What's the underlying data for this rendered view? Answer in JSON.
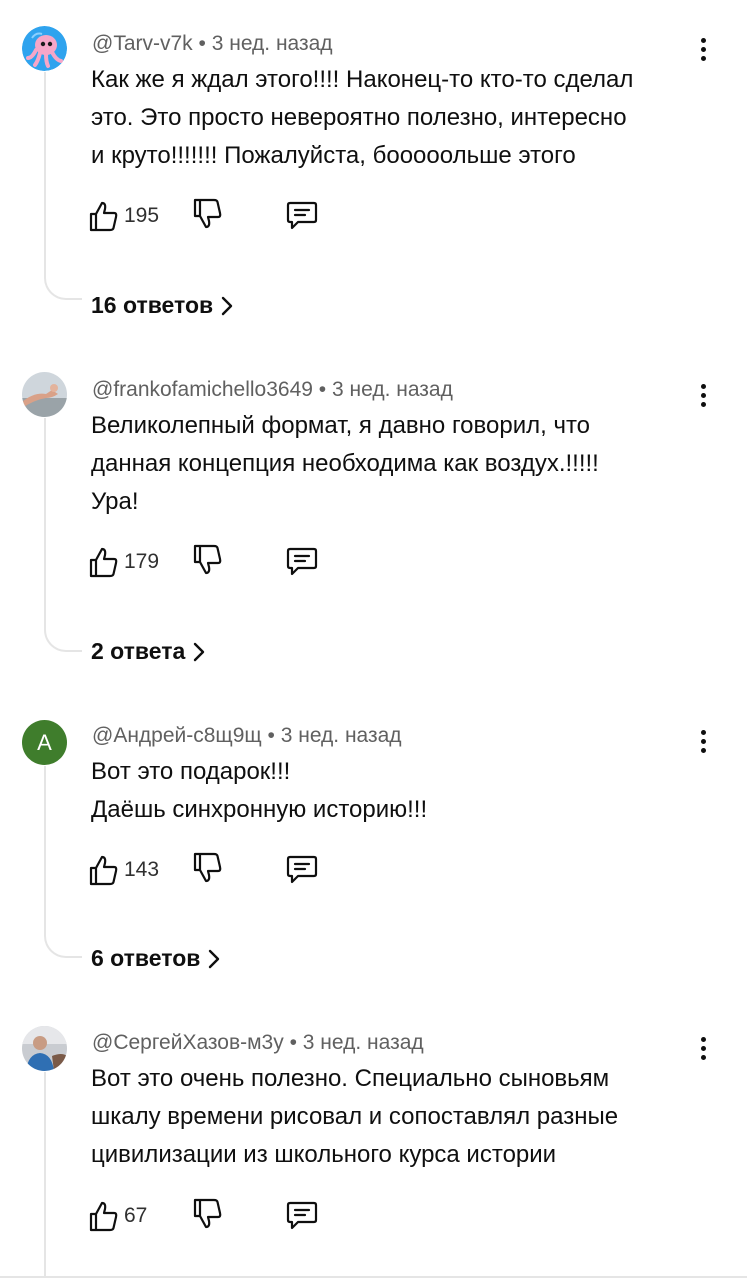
{
  "comments": [
    {
      "author": "@Tarv-v7k",
      "time": "3 нед. назад",
      "text": "Как же я ждал этого!!!! Наконец-то кто-то сделал\nэто. Это просто невероятно полезно, интересно\nи круто!!!!!!! Пожалуйста, бооооольше этого",
      "likes": "195",
      "replies": "16 ответов",
      "avatar": "octopus-avatar"
    },
    {
      "author": "@frankofamichello3649",
      "time": "3 нед. назад",
      "text": "Великолепный формат, я давно говорил, что\nданная концепция необходима как воздух.!!!!!\nУра!",
      "likes": "179",
      "replies": "2 ответа",
      "avatar": "photo-avatar"
    },
    {
      "author": "@Андрей-с8щ9щ",
      "time": "3 нед. назад",
      "text": "Вот это подарок!!!\nДаёшь синхронную историю!!!",
      "likes": "143",
      "replies": "6 ответов",
      "avatar_letter": "А",
      "avatar_color": "#3f7d2c"
    },
    {
      "author": "@СергейХазов-м3у",
      "time": "3 нед. назад",
      "text": "Вот это очень полезно. Специально сыновьям\nшкалу времени рисовал и сопоставлял разные\nцивилизации из школьного курса истории",
      "likes": "67",
      "avatar": "photo-avatar"
    }
  ],
  "icons": {
    "like": "thumbs-up-icon",
    "dislike": "thumbs-down-icon",
    "reply": "comment-icon",
    "menu": "more-vertical-icon",
    "chevron": "chevron-right-icon"
  },
  "colors": {
    "text": "#0f0f0f",
    "meta": "#606060",
    "thread_line": "#e5e5e5"
  }
}
